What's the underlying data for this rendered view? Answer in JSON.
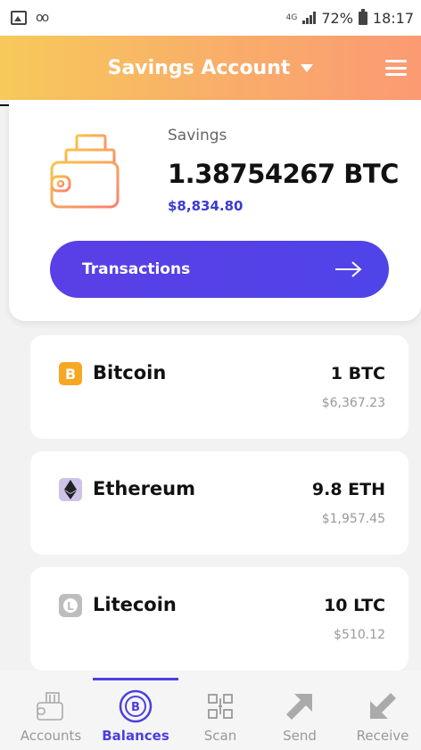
{
  "status_bar": {
    "network": "4G",
    "battery": "72%",
    "time": "18:17"
  },
  "header": {
    "title": "Savings Account"
  },
  "savings": {
    "label": "Savings",
    "amount": "1.38754267 BTC",
    "usd": "$8,834.80",
    "button_label": "Transactions"
  },
  "coins": [
    {
      "name": "Bitcoin",
      "amount": "1 BTC",
      "usd": "$6,367.23",
      "icon": "bitcoin-icon",
      "color": "#f7a823"
    },
    {
      "name": "Ethereum",
      "amount": "9.8 ETH",
      "usd": "$1,957.45",
      "icon": "ethereum-icon",
      "color": "#cfc2e8"
    },
    {
      "name": "Litecoin",
      "amount": "10 LTC",
      "usd": "$510.12",
      "icon": "litecoin-icon",
      "color": "#bdbdbd"
    }
  ],
  "bottom_nav": [
    {
      "label": "Accounts",
      "icon": "wallet-icon"
    },
    {
      "label": "Balances",
      "icon": "bitcoin-circle-icon",
      "active": true
    },
    {
      "label": "Scan",
      "icon": "qr-code-icon"
    },
    {
      "label": "Send",
      "icon": "send-arrow-icon"
    },
    {
      "label": "Receive",
      "icon": "receive-arrow-icon"
    }
  ],
  "colors": {
    "accent": "#4b3fe0",
    "header_gradient_start": "#f7c95a",
    "header_gradient_end": "#fb9a73"
  }
}
